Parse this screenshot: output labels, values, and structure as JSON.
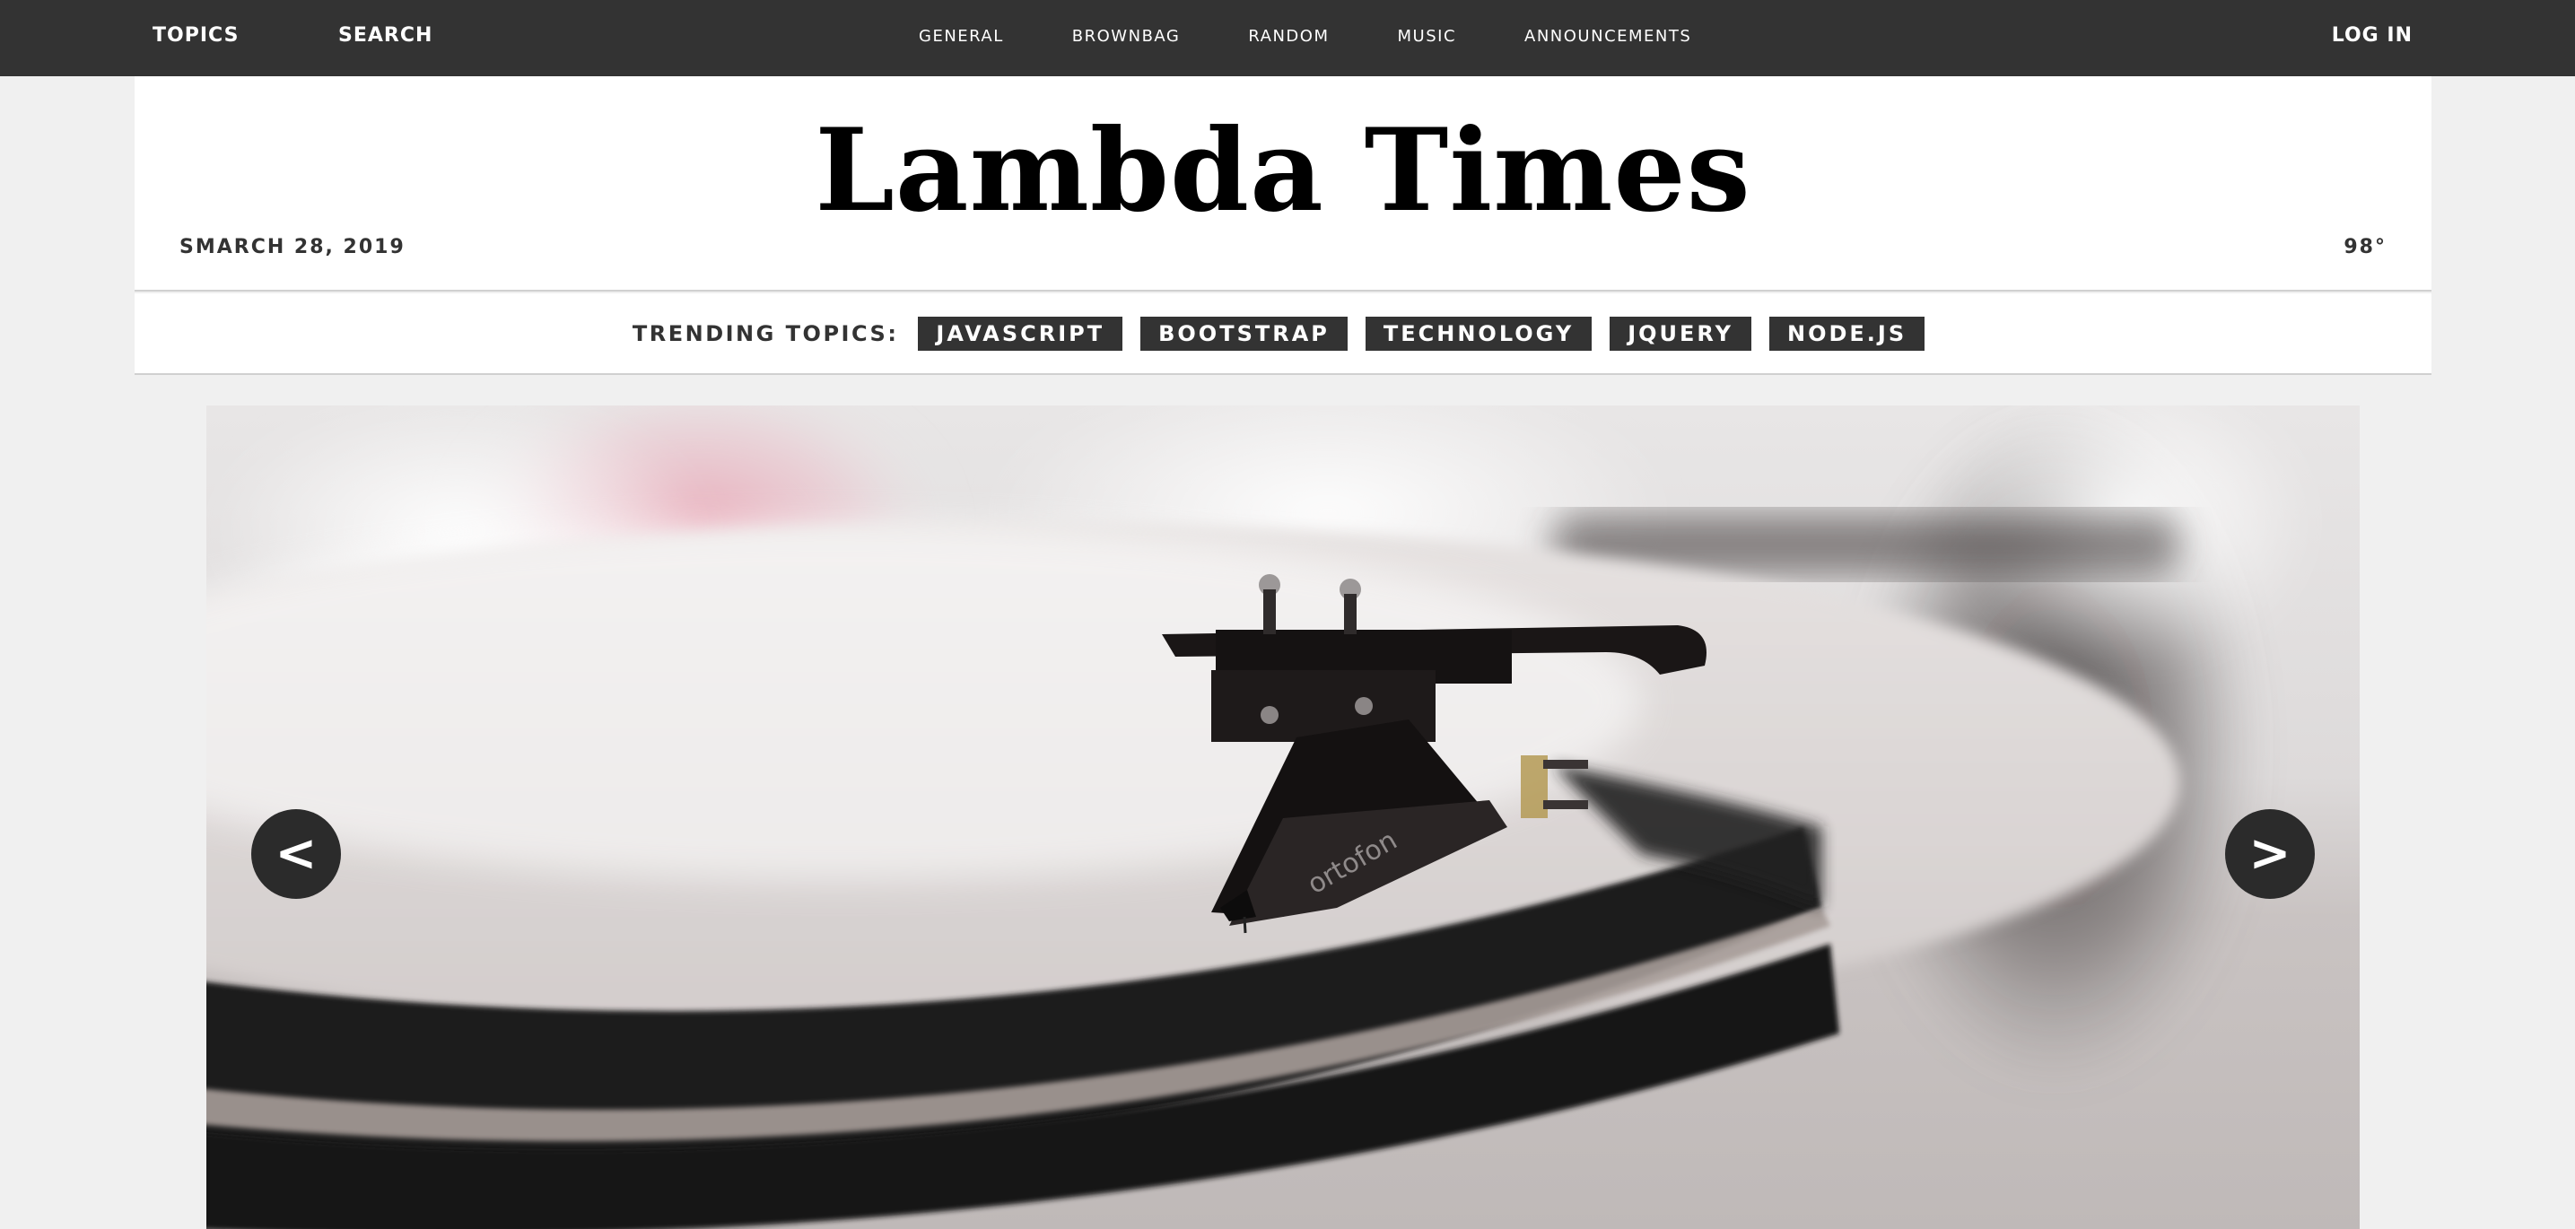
{
  "nav": {
    "topics_label": "TOPICS",
    "search_label": "SEARCH",
    "login_label": "LOG IN",
    "links": [
      {
        "label": "GENERAL"
      },
      {
        "label": "BROWNBAG"
      },
      {
        "label": "RANDOM"
      },
      {
        "label": "MUSIC"
      },
      {
        "label": "ANNOUNCEMENTS"
      }
    ]
  },
  "header": {
    "title": "Lambda Times",
    "date": "SMARCH 28, 2019",
    "temperature": "98°"
  },
  "trending": {
    "label": "TRENDING TOPICS:",
    "tabs": [
      {
        "label": "JAVASCRIPT"
      },
      {
        "label": "BOOTSTRAP"
      },
      {
        "label": "TECHNOLOGY"
      },
      {
        "label": "JQUERY"
      },
      {
        "label": "NODE.JS"
      }
    ]
  },
  "carousel": {
    "prev_label": "<",
    "next_label": ">",
    "image_subject": "turntable-tonearm-image",
    "image_text": "ortofon"
  },
  "colors": {
    "nav_background": "#333333",
    "page_background": "#f0f0f0",
    "tab_background": "#333333",
    "text_dark": "#333333",
    "white": "#ffffff"
  }
}
